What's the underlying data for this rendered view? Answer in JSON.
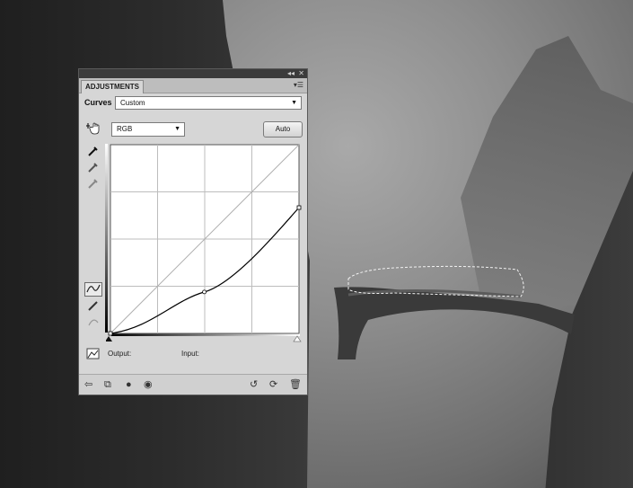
{
  "panel": {
    "tab_label": "ADJUSTMENTS",
    "topbar_collapse": "◂◂",
    "topbar_close": "✕",
    "menu_icon": "panel-menu-icon",
    "adjustment_name": "Curves",
    "preset_value": "Custom",
    "channel_value": "RGB",
    "auto_label": "Auto",
    "output_label": "Output:",
    "input_label": "Input:"
  },
  "curve": {
    "points_input_output": [
      [
        0,
        0
      ],
      [
        127,
        56
      ],
      [
        255,
        170
      ]
    ],
    "grid_divisions": 4
  },
  "tools": {
    "on_image": "hand-target-icon",
    "eyedroppers": [
      "black-eyedropper-icon",
      "gray-eyedropper-icon",
      "white-eyedropper-icon"
    ],
    "curve_mode": "curve-point-icon",
    "pencil_mode": "pencil-icon",
    "smooth": "smooth-icon",
    "clipping": "clipping-warning-icon"
  },
  "bottom_icons": [
    "return-icon",
    "clip-to-layer-icon",
    "layer-visibility-icon",
    "view-previous-icon",
    "reset-icon",
    "refresh-icon",
    "delete-icon"
  ]
}
